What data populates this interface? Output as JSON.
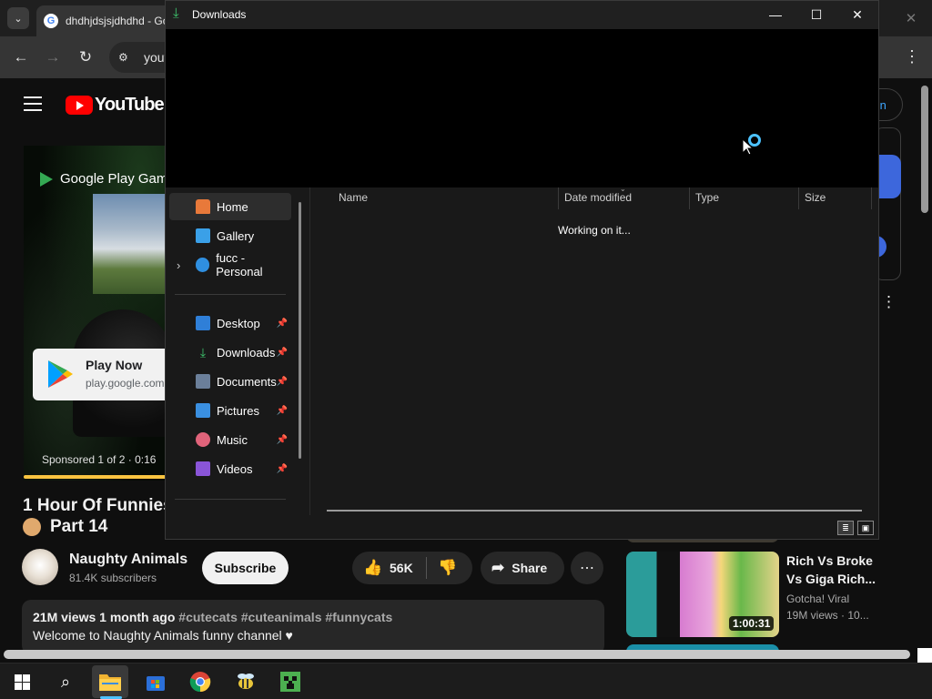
{
  "browser": {
    "tab_title": "dhdhjdsjsjdhdhd - Go",
    "tab_menu_glyph": "⌄",
    "close_glyph": "✕",
    "omnibox_text": "yout",
    "nav": {
      "back": "←",
      "forward": "→",
      "reload": "↻"
    }
  },
  "youtube": {
    "logo_text": "YouTube",
    "signin_label": "In",
    "ad": {
      "brand": "Google Play Game",
      "cta_title": "Play Now",
      "cta_url": "play.google.com",
      "sponsored": "Sponsored 1 of 2 · 0:16"
    },
    "video": {
      "title_line1": "1 Hour Of Funnies",
      "title_line2": "Part 14",
      "channel_name": "Naughty Animals",
      "subscribers": "81.4K subscribers",
      "subscribe_label": "Subscribe",
      "likes": "56K",
      "share_label": "Share",
      "views": "21M views",
      "age": "1 month ago",
      "tags": "#cutecats #cuteanimals #funnycats",
      "description": "Welcome to Naughty Animals funny channel ♥"
    },
    "related": {
      "title": "Rich Vs Broke Vs Giga Rich...",
      "channel": "Gotcha! Viral",
      "views": "19M views · 10...",
      "duration": "1:00:31"
    }
  },
  "explorer": {
    "window_title": "Downloads",
    "controls": {
      "minimize": "—",
      "maximize": "☐",
      "close": "✕"
    },
    "nav_items": [
      {
        "label": "Home",
        "selected": true,
        "pinned": false
      },
      {
        "label": "Gallery",
        "selected": false,
        "pinned": false
      },
      {
        "label": "fucc - Personal",
        "selected": false,
        "pinned": false,
        "expandable": true
      },
      {
        "label": "Desktop",
        "selected": false,
        "pinned": true
      },
      {
        "label": "Downloads",
        "selected": false,
        "pinned": true
      },
      {
        "label": "Documents",
        "selected": false,
        "pinned": true
      },
      {
        "label": "Pictures",
        "selected": false,
        "pinned": true
      },
      {
        "label": "Music",
        "selected": false,
        "pinned": true
      },
      {
        "label": "Videos",
        "selected": false,
        "pinned": true
      }
    ],
    "columns": [
      "Name",
      "Date modified",
      "Type",
      "Size"
    ],
    "status_text": "Working on it..."
  },
  "taskbar": {
    "items": [
      "start",
      "search",
      "file-explorer",
      "microsoft-store",
      "chrome",
      "bee-app",
      "minecraft"
    ]
  },
  "colors": {
    "accent_blue": "#4cc2ff",
    "youtube_red": "#ff0000",
    "link_blue": "#3ea6ff"
  }
}
